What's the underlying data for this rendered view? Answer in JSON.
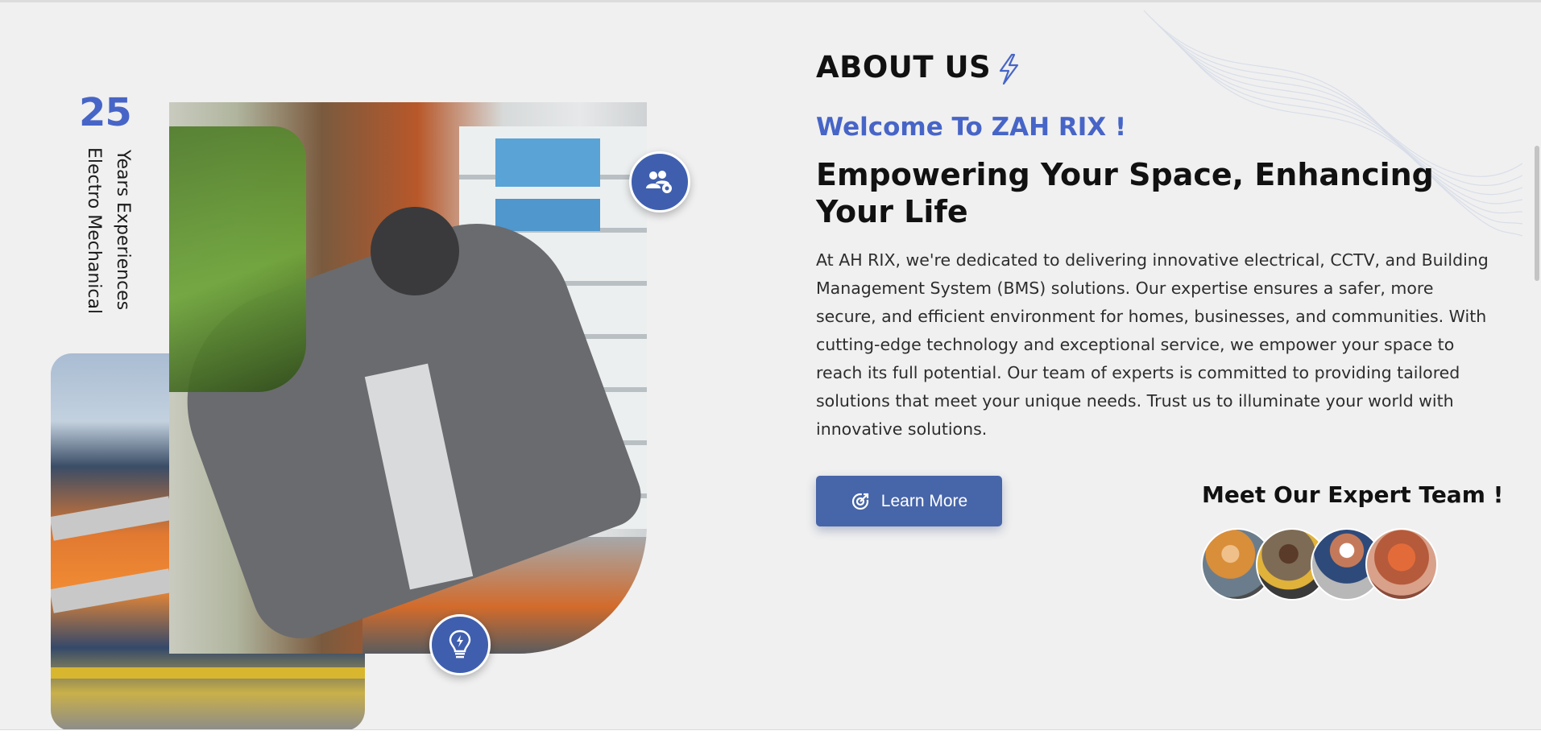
{
  "about": {
    "section_title": "ABOUT US",
    "welcome": "Welcome To ZAH RIX !",
    "headline": "Empowering Your Space, Enhancing Your Life",
    "paragraph": "At AH RIX, we're dedicated to delivering innovative electrical, CCTV, and Building Management System (BMS) solutions. Our expertise ensures a safer, more secure, and efficient environment for homes, businesses, and communities. With cutting-edge technology and exceptional service, we empower your space to reach its full potential. Our team of experts is committed to providing tailored solutions that meet your unique needs. Trust us to illuminate your world with innovative solutions.",
    "cta_label": "Learn More",
    "team_title": "Meet Our Expert Team !"
  },
  "experience": {
    "years": "25",
    "years_label": "Years Experiences",
    "field_label": "Electro Mechanical"
  },
  "icons": [
    "bolt-icon",
    "team-settings-icon",
    "bulb-icon",
    "target-arrow-icon"
  ],
  "colors": {
    "accent": "#4765c7",
    "button": "#4765a9",
    "circle": "#3f5fae",
    "background": "#f0f0f0",
    "text": "#111111"
  }
}
